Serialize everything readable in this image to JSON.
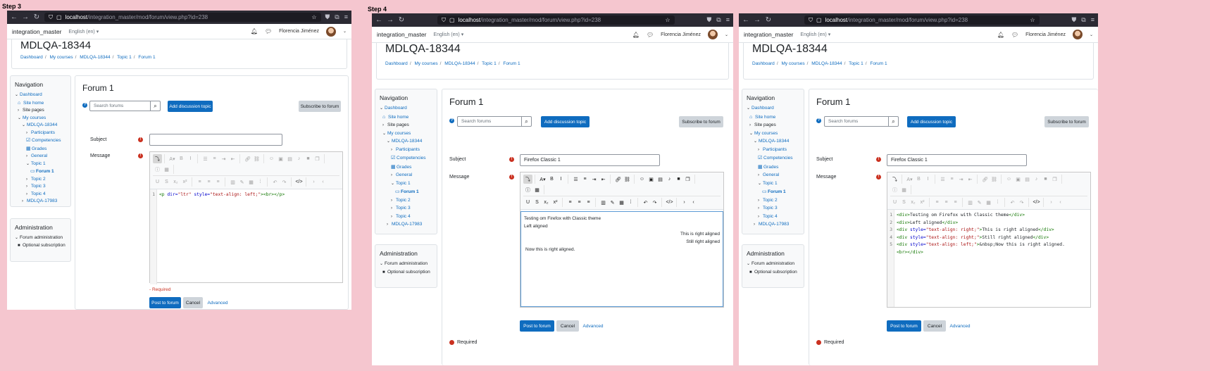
{
  "steps": [
    {
      "label": "Step 3",
      "url_host": "localhost",
      "url_path": "/integration_master/mod/forum/view.php?id=238",
      "site_name": "integration_master",
      "lang": "English (en) ▾",
      "user": "Florencia Jiménez",
      "course_title": "MDLQA-18344",
      "breadcrumb": [
        "Dashboard",
        "My courses",
        "MDLQA-18344",
        "Topic 1",
        "Forum 1"
      ],
      "forum_title": "Forum 1",
      "search_placeholder": "Search forums",
      "add_discussion": "Add discussion topic",
      "subscribe": "Subscribe to forum",
      "subject_label": "Subject",
      "subject_value": "",
      "message_label": "Message",
      "code_lines": [
        "1"
      ],
      "required_label": "- Required",
      "post_button": "Post to forum",
      "cancel_button": "Cancel",
      "advanced_link": "Advanced"
    },
    {
      "label": "Step 4",
      "url_host": "localhost",
      "url_path": "/integration_master/mod/forum/view.php?id=238",
      "site_name": "integration_master",
      "lang": "English (en) ▾",
      "user": "Florencia Jiménez",
      "course_title": "MDLQA-18344",
      "breadcrumb": [
        "Dashboard",
        "My courses",
        "MDLQA-18344",
        "Topic 1",
        "Forum 1"
      ],
      "forum_title": "Forum 1",
      "search_placeholder": "Search forums",
      "add_discussion": "Add discussion topic",
      "subscribe": "Subscribe to forum",
      "subject_label": "Subject",
      "subject_value": "Firefox Classic 1",
      "message_label": "Message",
      "wysiwyg": [
        "Testing om Firefox with Classic theme",
        "Left aligned",
        "This is right aligned",
        "Still right aligned",
        "Now this is right aligned."
      ],
      "required_label": "Required",
      "post_button": "Post to forum",
      "cancel_button": "Cancel",
      "advanced_link": "Advanced"
    },
    {
      "url_host": "localhost",
      "url_path": "/integration_master/mod/forum/view.php?id=238",
      "site_name": "integration_master",
      "lang": "English (en) ▾",
      "user": "Florencia Jiménez",
      "course_title": "MDLQA-18344",
      "breadcrumb": [
        "Dashboard",
        "My courses",
        "MDLQA-18344",
        "Topic 1",
        "Forum 1"
      ],
      "forum_title": "Forum 1",
      "search_placeholder": "Search forums",
      "add_discussion": "Add discussion topic",
      "subscribe": "Subscribe to forum",
      "subject_label": "Subject",
      "subject_value": "Firefox Classic 1",
      "message_label": "Message",
      "code_lines": [
        "1",
        "2",
        "3",
        "4",
        "5"
      ],
      "required_label": "Required",
      "post_button": "Post to forum",
      "cancel_button": "Cancel",
      "advanced_link": "Advanced"
    }
  ],
  "navigation": {
    "title": "Navigation",
    "dashboard": "Dashboard",
    "site_home": "Site home",
    "site_pages": "Site pages",
    "my_courses": "My courses",
    "course": "MDLQA-18344",
    "participants": "Participants",
    "competencies": "Competencies",
    "grades": "Grades",
    "general": "General",
    "topic1": "Topic 1",
    "forum1": "Forum 1",
    "topic2": "Topic 2",
    "topic3": "Topic 3",
    "topic4": "Topic 4",
    "other_course": "MDLQA-17983"
  },
  "administration": {
    "title": "Administration",
    "forum_admin": "Forum administration",
    "optional_sub": "Optional subscription"
  },
  "code": {
    "step3_line1": {
      "tag_open": "<p",
      "attr1": " dir=",
      "val1": "\"ltr\"",
      "attr2": " style=",
      "val2": "\"text-align: left;\"",
      "rest": "><br></p>"
    },
    "step4_lines": [
      {
        "open": "<div>",
        "text": "Testing om Firefox with Classic theme",
        "close": "</div>"
      },
      {
        "open": "<div>",
        "text": "Left aligned",
        "close": "</div>"
      },
      {
        "open": "<div",
        "attr": " style=",
        "val": "\"text-align: right;\"",
        "gt": ">",
        "text": "This is right aligned",
        "close": "</div>"
      },
      {
        "open": "<div",
        "attr": " style=",
        "val": "\"text-align: right;\"",
        "gt": ">",
        "text": "Still right aligned",
        "close": "</div>"
      },
      {
        "open": "<div",
        "attr": " style=",
        "val": "\"text-align: left;\"",
        "gt": ">",
        "text": "&nbsp;Now this is right aligned.",
        "close": ""
      },
      {
        "open": "<br>",
        "text": "",
        "close": "</div>"
      }
    ]
  },
  "colors": {
    "primary": "#0f6cbf",
    "required": "#ca3120",
    "background": "#f5c6cf"
  }
}
